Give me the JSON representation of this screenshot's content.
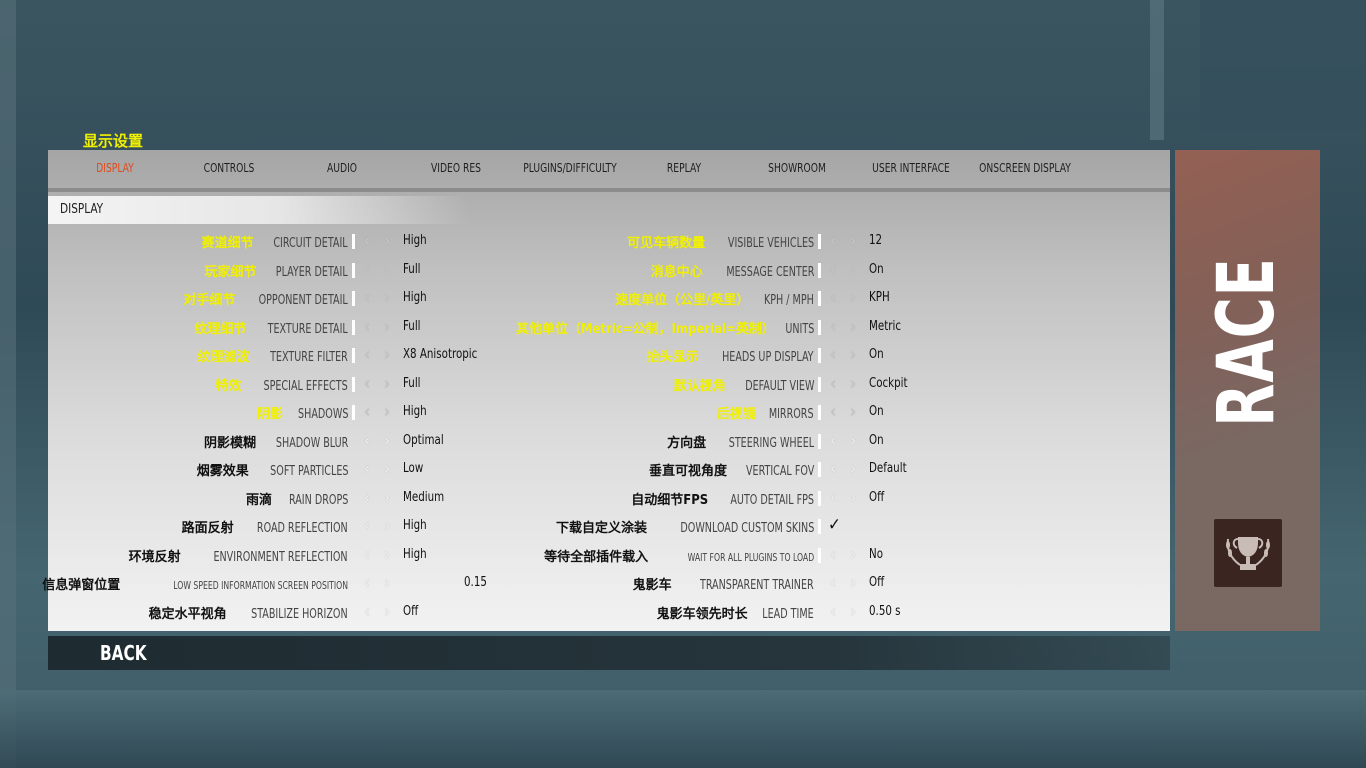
{
  "header": {
    "section_title": "显示设置"
  },
  "tabs": [
    {
      "label": "DISPLAY",
      "active": true
    },
    {
      "label": "CONTROLS",
      "active": false
    },
    {
      "label": "AUDIO",
      "active": false
    },
    {
      "label": "VIDEO RES",
      "active": false
    },
    {
      "label": "PLUGINS/DIFFICULTY",
      "active": false
    },
    {
      "label": "REPLAY",
      "active": false
    },
    {
      "label": "SHOWROOM",
      "active": false
    },
    {
      "label": "USER INTERFACE",
      "active": false
    },
    {
      "label": "ONSCREEN DISPLAY",
      "active": false
    }
  ],
  "section": {
    "label": "DISPLAY"
  },
  "colors": {
    "accent_tab": "#e04a1a",
    "cn_highlight": "#f0f000",
    "side_panel": "#7a6863"
  },
  "settings_left": [
    {
      "cn": "赛道细节",
      "en": "CIRCUIT DETAIL",
      "value": "High",
      "cn_yellow": true
    },
    {
      "cn": "玩家细节",
      "en": "PLAYER DETAIL",
      "value": "Full",
      "cn_yellow": true
    },
    {
      "cn": "对手细节",
      "en": "OPPONENT DETAIL",
      "value": "High",
      "cn_yellow": true
    },
    {
      "cn": "纹理细节",
      "en": "TEXTURE DETAIL",
      "value": "Full",
      "cn_yellow": true
    },
    {
      "cn": "纹理滤波",
      "en": "TEXTURE FILTER",
      "value": "X8 Anisotropic",
      "cn_yellow": true
    },
    {
      "cn": "特效",
      "en": "SPECIAL EFFECTS",
      "value": "Full",
      "cn_yellow": true
    },
    {
      "cn": "阴影",
      "en": "SHADOWS",
      "value": "High",
      "cn_yellow": true
    },
    {
      "cn": "阴影模糊",
      "en": "SHADOW BLUR",
      "value": "Optimal",
      "cn_yellow": false
    },
    {
      "cn": "烟雾效果",
      "en": "SOFT PARTICLES",
      "value": "Low",
      "cn_yellow": false
    },
    {
      "cn": "雨滴",
      "en": "RAIN DROPS",
      "value": "Medium",
      "cn_yellow": false
    },
    {
      "cn": "路面反射",
      "en": "ROAD REFLECTION",
      "value": "High",
      "cn_yellow": false
    },
    {
      "cn": "环境反射",
      "en": "ENVIRONMENT REFLECTION",
      "value": "High",
      "cn_yellow": false
    },
    {
      "cn": "信息弹窗位置",
      "en": "LOW SPEED INFORMATION SCREEN POSITION",
      "value": "0.15",
      "cn_yellow": false
    },
    {
      "cn": "稳定水平视角",
      "en": "STABILIZE HORIZON",
      "value": "Off",
      "cn_yellow": false
    }
  ],
  "settings_right": [
    {
      "cn": "可见车辆数量",
      "en": "VISIBLE VEHICLES",
      "value": "12",
      "cn_yellow": true
    },
    {
      "cn": "消息中心",
      "en": "MESSAGE CENTER",
      "value": "On",
      "cn_yellow": true
    },
    {
      "cn": "速度单位（公里/英里）",
      "en": "KPH / MPH",
      "value": "KPH",
      "cn_yellow": true
    },
    {
      "cn": "其他单位（Metric=公制，Imperial=英制）",
      "en": "UNITS",
      "value": "Metric",
      "cn_yellow": true
    },
    {
      "cn": "抬头显示",
      "en": "HEADS UP DISPLAY",
      "value": "On",
      "cn_yellow": true
    },
    {
      "cn": "默认视角",
      "en": "DEFAULT VIEW",
      "value": "Cockpit",
      "cn_yellow": true
    },
    {
      "cn": "后视镜",
      "en": "MIRRORS",
      "value": "On",
      "cn_yellow": true
    },
    {
      "cn": "方向盘",
      "en": "STEERING WHEEL",
      "value": "On",
      "cn_yellow": false
    },
    {
      "cn": "垂直可视角度",
      "en": "VERTICAL FOV",
      "value": "Default",
      "cn_yellow": false
    },
    {
      "cn": "自动细节FPS",
      "en": "AUTO DETAIL FPS",
      "value": "Off",
      "cn_yellow": false
    },
    {
      "cn": "下载自定义涂装",
      "en": "DOWNLOAD CUSTOM SKINS",
      "value": "✓",
      "cn_yellow": false
    },
    {
      "cn": "等待全部插件载入",
      "en": "WAIT FOR ALL PLUGINS TO LOAD",
      "value": "No",
      "cn_yellow": false
    },
    {
      "cn": "鬼影车",
      "en": "TRANSPARENT TRAINER",
      "value": "Off",
      "cn_yellow": false
    },
    {
      "cn": "鬼影车领先时长",
      "en": "LEAD TIME",
      "value": "0.50 s",
      "cn_yellow": false
    }
  ],
  "footer": {
    "back_label": "BACK"
  },
  "side": {
    "mode_label": "RACE",
    "icon": "trophy-icon"
  }
}
